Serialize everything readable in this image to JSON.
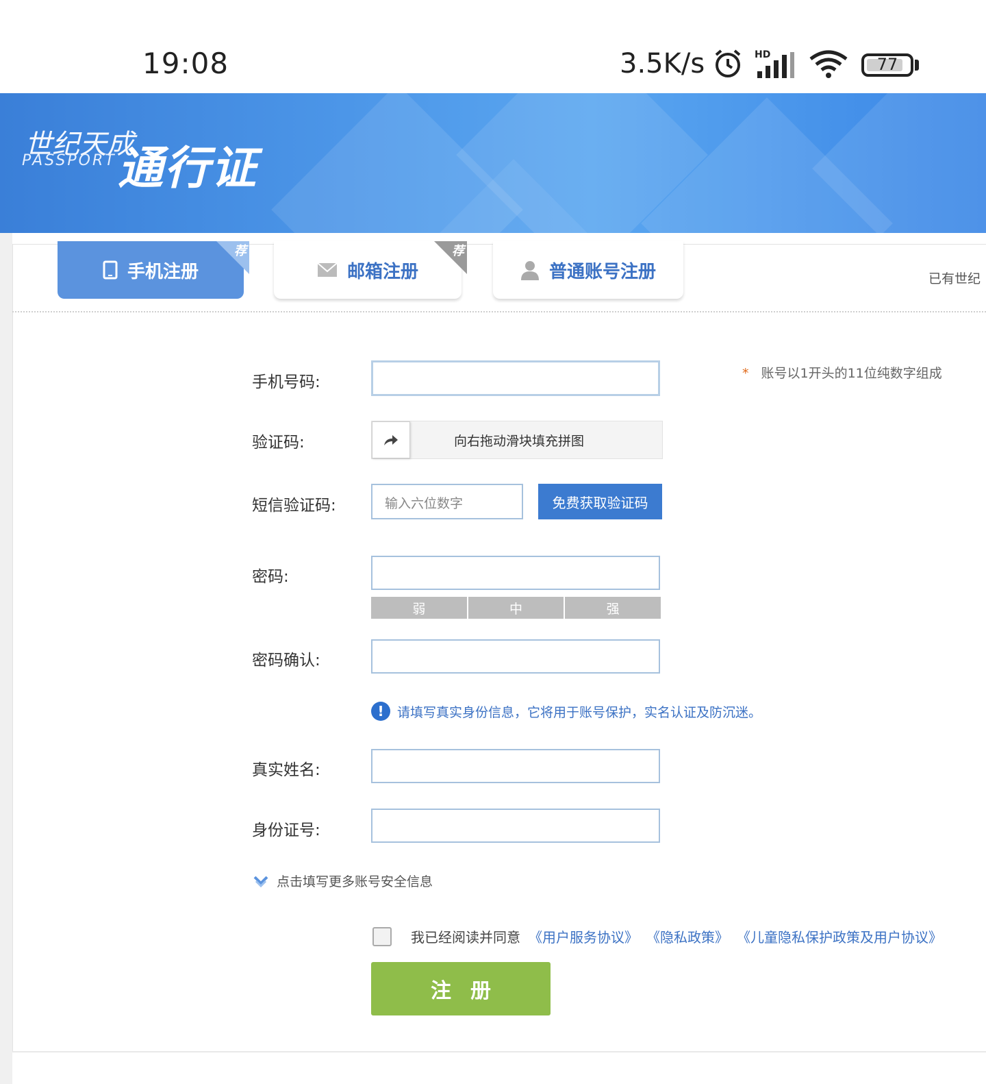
{
  "status_bar": {
    "time": "19:08",
    "speed": "3.5K/s",
    "battery": "77"
  },
  "banner": {
    "logo_top": "世纪天成",
    "logo_passport": "PASSPORT",
    "logo_main": "通行证"
  },
  "tabs": [
    {
      "label": "手机注册",
      "icon": "phone-icon",
      "active": true,
      "badge": "荐"
    },
    {
      "label": "邮箱注册",
      "icon": "mail-icon",
      "active": false,
      "badge": "荐"
    },
    {
      "label": "普通账号注册",
      "icon": "user-icon",
      "active": false,
      "badge": ""
    }
  ],
  "already_text": "已有世纪",
  "form": {
    "phone": {
      "label": "手机号码:",
      "value": "",
      "hint": "账号以1开头的11位纯数字组成",
      "required_mark": "*"
    },
    "captcha": {
      "label": "验证码:",
      "slider_text": "向右拖动滑块填充拼图"
    },
    "sms": {
      "label": "短信验证码:",
      "placeholder": "输入六位数字",
      "button": "免费获取验证码"
    },
    "password": {
      "label": "密码:",
      "strength": [
        "弱",
        "中",
        "强"
      ]
    },
    "password_confirm": {
      "label": "密码确认:"
    },
    "notice": "请填写真实身份信息，它将用于账号保护，实名认证及防沉迷。",
    "real_name": {
      "label": "真实姓名:"
    },
    "id_number": {
      "label": "身份证号:"
    },
    "more_info": "点击填写更多账号安全信息",
    "agree": {
      "text": "我已经阅读并同意",
      "links": [
        "《用户服务协议》",
        "《隐私政策》",
        "《儿童隐私保护政策及用户协议》"
      ]
    },
    "submit": "注册"
  },
  "colors": {
    "accent": "#3c7bd0",
    "submit": "#8fbd4a",
    "tab_active": "#5b93de"
  }
}
